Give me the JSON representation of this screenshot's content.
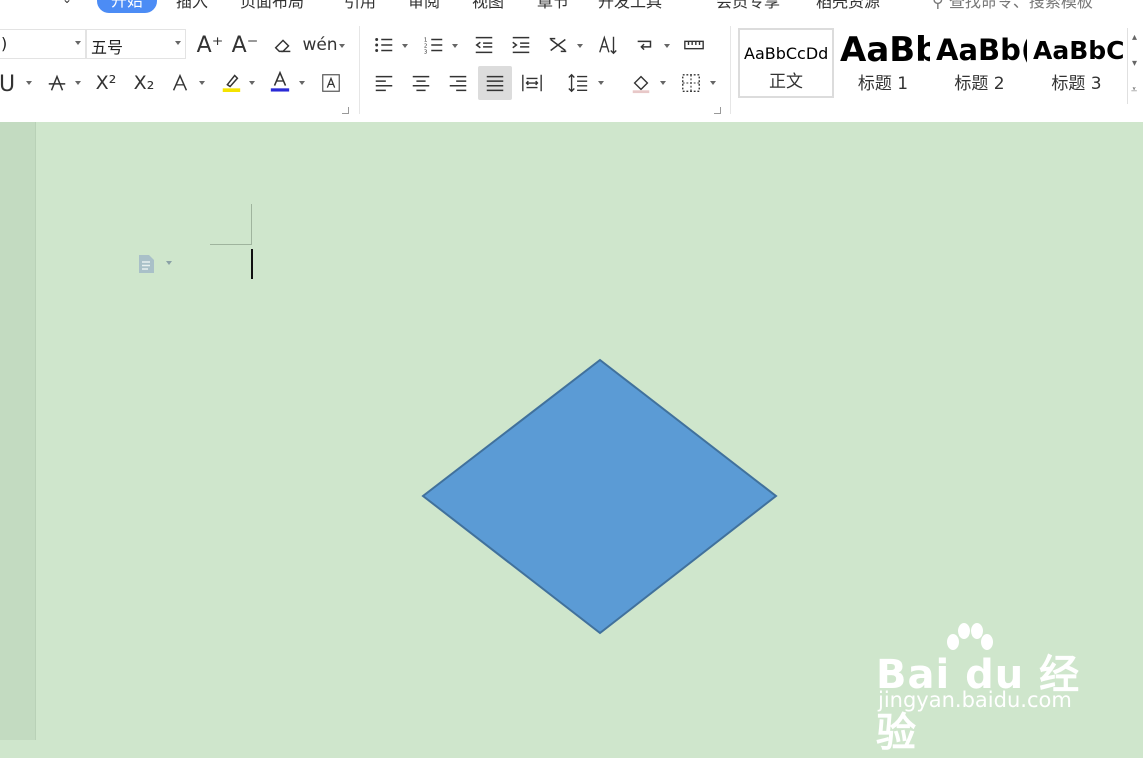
{
  "menubar": {
    "tabs": [
      "开始",
      "插入",
      "页面布局",
      "引用",
      "审阅",
      "视图",
      "章节",
      "开发工具",
      "会员专享",
      "稻壳资源"
    ],
    "active_tab": "开始",
    "search_text": "查找命令、搜索模板"
  },
  "font": {
    "name_value": ")",
    "size_value": "五号"
  },
  "toolbar": {
    "grow_font_label": "A⁺",
    "shrink_font_label": "A⁻",
    "phonetic_label": "wén",
    "superscript_label": "X²",
    "subscript_label": "X₂",
    "highlight_color": "#f4e300",
    "font_color": "#2a2ad6"
  },
  "styles": [
    {
      "sample": "AaBbCcDd",
      "name": "正文"
    },
    {
      "sample": "AaBb",
      "name": "标题 1"
    },
    {
      "sample": "AaBb(",
      "name": "标题 2"
    },
    {
      "sample": "AaBbC",
      "name": "标题 3"
    }
  ],
  "document": {
    "background_color": "#cfe6cc",
    "shape": {
      "type": "diamond",
      "fill": "#5b9bd5",
      "stroke": "#41719c"
    }
  },
  "watermark": {
    "brand": "Bai du 经验",
    "url": "jingyan.baidu.com"
  }
}
